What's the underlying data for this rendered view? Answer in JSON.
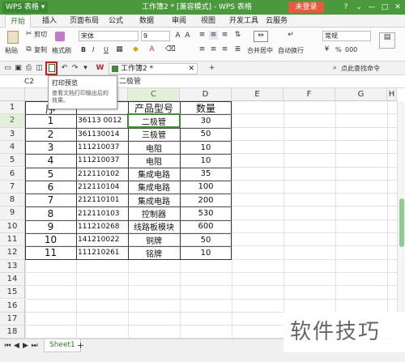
{
  "app": {
    "name": "WPS 表格",
    "doc_title": "工作簿2 * [兼容模式] - WPS 表格",
    "login_label": "未登录",
    "window_controls": [
      "?",
      "⌄",
      "—",
      "□",
      "✕"
    ]
  },
  "ribbon_tabs": [
    "开始",
    "插入",
    "页面布局",
    "公式",
    "数据",
    "审阅",
    "视图",
    "开发工具",
    "云服务"
  ],
  "ribbon": {
    "paste": "粘贴",
    "cut": "剪切",
    "copy": "复制",
    "format_painter": "格式刷",
    "font_name": "宋体",
    "font_size": "9",
    "bold": "B",
    "italic": "I",
    "underline": "U",
    "merge_center": "合并居中",
    "wrap_text": "自动换行",
    "number_format": "常规",
    "percent": "%",
    "thousands": "000"
  },
  "toolbar2": {
    "doc_tab": "工作簿2 *",
    "add_tab": "+",
    "help_search": "点此查找命令"
  },
  "tooltip": {
    "title": "打印预览",
    "description": "查看文档打印输出后的效果。"
  },
  "formula_bar": {
    "cell_ref": "C2",
    "content": "二极管"
  },
  "columns": [
    "A",
    "B",
    "C",
    "D",
    "E",
    "F",
    "G",
    "H"
  ],
  "rows": [
    "1",
    "2",
    "3",
    "4",
    "5",
    "6",
    "7",
    "8",
    "9",
    "10",
    "11",
    "12",
    "13",
    "14",
    "15",
    "16",
    "17",
    "18"
  ],
  "table": {
    "header": [
      "序号",
      "",
      "产品型号",
      "数量"
    ],
    "header_visible_A": "序",
    "data": [
      [
        "1",
        "36113    0012",
        "二极管",
        "30"
      ],
      [
        "2",
        "361130014",
        "三极管",
        "50"
      ],
      [
        "3",
        "111210037",
        "电阻",
        "10"
      ],
      [
        "4",
        "111210037",
        "电阻",
        "10"
      ],
      [
        "5",
        "212110102",
        "集成电路",
        "35"
      ],
      [
        "6",
        "212110104",
        "集成电路",
        "100"
      ],
      [
        "7",
        "212110101",
        "集成电路",
        "200"
      ],
      [
        "8",
        "212110103",
        "控制器",
        "530"
      ],
      [
        "9",
        "111210268",
        "线路板模块",
        "600"
      ],
      [
        "10",
        "141210022",
        "铜牌",
        "50"
      ],
      [
        "11",
        "111210261",
        "铭牌",
        "10"
      ]
    ]
  },
  "sheet_tabs": [
    "Sheet1"
  ],
  "sheet_add": "+",
  "watermark": "软件技巧"
}
